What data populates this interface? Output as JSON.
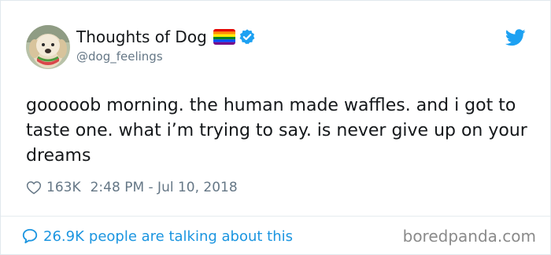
{
  "author": {
    "display_name": "Thoughts of Dog",
    "handle": "@dog_feelings",
    "avatar_icon": "dog-avatar",
    "verified": true
  },
  "icons": {
    "flag": "rainbow-flag-icon",
    "verified": "verified-badge-icon",
    "brand": "twitter-bird-icon",
    "like": "heart-icon",
    "conversation": "speech-bubble-icon"
  },
  "tweet": {
    "text": "gooooob morning. the human made waffles. and i got to taste one. what i’m trying to say. is never give up on your dreams",
    "like_count": "163K",
    "timestamp": "2:48 PM - Jul 10, 2018"
  },
  "footer": {
    "talk_count": "26.9K",
    "talk_text": "people are talking about this"
  },
  "watermark": "boredpanda.com",
  "colors": {
    "twitter_blue": "#1da1f2",
    "link_blue": "#1b95e0",
    "text_primary": "#14171a",
    "text_secondary": "#657786",
    "border": "#e1e8ed"
  }
}
